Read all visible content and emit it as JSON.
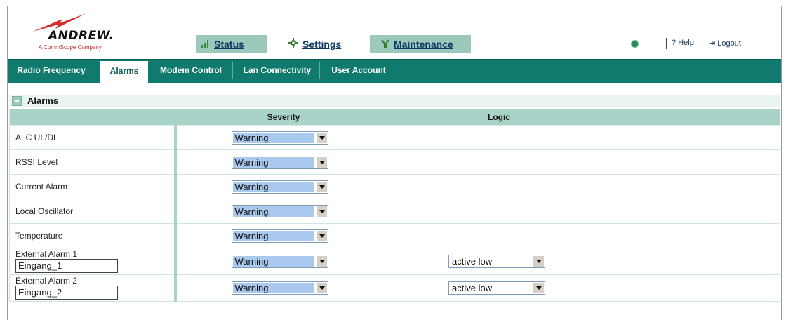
{
  "brand": {
    "name": "ANDREW.",
    "tagline": "A CommScope Company"
  },
  "top_tabs": [
    {
      "label": "Status",
      "icon": "signal-bars-icon"
    },
    {
      "label": "Settings",
      "icon": "gear-icon"
    },
    {
      "label": "Maintenance",
      "icon": "tools-icon"
    }
  ],
  "header_right": {
    "help": "Help",
    "logout": "Logout"
  },
  "sub_tabs": [
    {
      "label": "Radio Frequency"
    },
    {
      "label": "Alarms"
    },
    {
      "label": "Modem Control"
    },
    {
      "label": "Lan Connectivity"
    },
    {
      "label": "User Account"
    }
  ],
  "section": {
    "title": "Alarms"
  },
  "table": {
    "headers": [
      "",
      "Severity",
      "Logic",
      ""
    ],
    "rows": [
      {
        "name": "ALC UL/DL",
        "severity": "Warning"
      },
      {
        "name": "RSSI Level",
        "severity": "Warning"
      },
      {
        "name": "Current Alarm",
        "severity": "Warning"
      },
      {
        "name": "Local Oscillator",
        "severity": "Warning"
      },
      {
        "name": "Temperature",
        "severity": "Warning"
      },
      {
        "name": "External Alarm 1",
        "input": "Eingang_1",
        "severity": "Warning",
        "logic": "active low"
      },
      {
        "name": "External Alarm 2",
        "input": "Eingang_2",
        "severity": "Warning",
        "logic": "active low"
      }
    ]
  },
  "colors": {
    "accent": "#117a6f",
    "header_row": "#a9d3c8",
    "tab": "#9dc9bd",
    "select_highlight": "#a9c9ef"
  }
}
